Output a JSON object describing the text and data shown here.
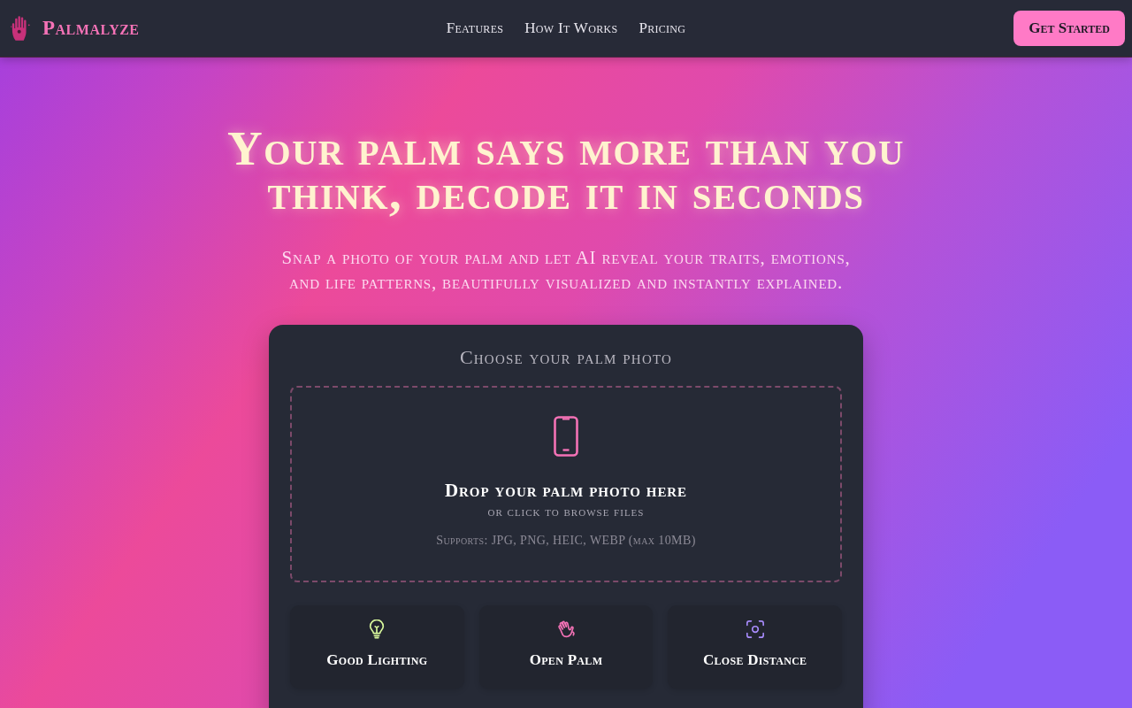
{
  "nav": {
    "brand": "Palmalyze",
    "links": [
      "Features",
      "How It Works",
      "Pricing"
    ],
    "cta": "Get Started"
  },
  "hero": {
    "title": "Your palm says more than you think, decode it in seconds",
    "subtitle": "Snap a photo of your palm and let AI reveal your traits, emotions, and life patterns, beautifully visualized and instantly explained."
  },
  "upload": {
    "heading": "Choose your palm photo",
    "dropzone": {
      "title": "Drop your palm photo here",
      "hint": "or click to browse files",
      "formats": "Supports: JPG, PNG, HEIC, WEBP (max 10MB)"
    },
    "tips": [
      {
        "label": "Good Lighting",
        "color": "#d9f99d"
      },
      {
        "label": "Open Palm",
        "color": "#f472b6"
      },
      {
        "label": "Close Distance",
        "color": "#a78bfa"
      }
    ]
  }
}
